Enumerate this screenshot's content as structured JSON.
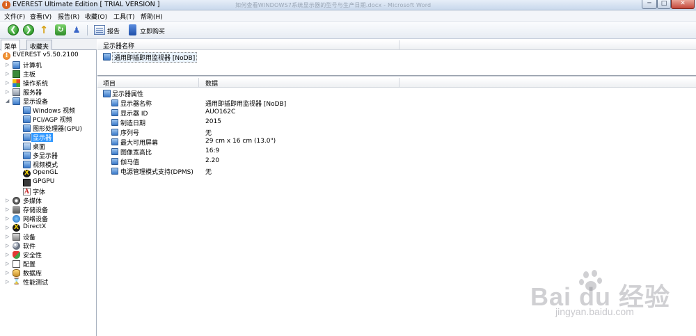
{
  "window": {
    "title": "EVEREST Ultimate Edition  [ TRIAL VERSION ]",
    "background_title": "如何查看WINDOWS7系统显示器的型号与生产日期.docx - Microsoft Word",
    "min_glyph": "─",
    "max_glyph": "□",
    "close_glyph": "✕"
  },
  "menu": [
    "文件(F)",
    "查看(V)",
    "报告(R)",
    "收藏(O)",
    "工具(T)",
    "帮助(H)"
  ],
  "toolbar": {
    "back_glyph": "❮",
    "forward_glyph": "❯",
    "up_glyph": "↑",
    "refresh_glyph": "↻",
    "users_glyph": "♟",
    "report_label": "报告",
    "buy_label": "立即购买"
  },
  "left_tabs": {
    "menu": "菜单",
    "favorites": "收藏夹"
  },
  "tree": {
    "root": "EVEREST v5.50.2100",
    "items": [
      {
        "label": "计算机",
        "icon": "computer-icon"
      },
      {
        "label": "主板",
        "icon": "motherboard-icon"
      },
      {
        "label": "操作系统",
        "icon": "windows-icon"
      },
      {
        "label": "服务器",
        "icon": "server-icon"
      },
      {
        "label": "显示设备",
        "icon": "monitor-icon"
      }
    ],
    "display_children": [
      "Windows 视频",
      "PCI/AGP 视频",
      "图形处理器(GPU)",
      "显示器",
      "桌面",
      "多显示器",
      "视频模式",
      "OpenGL",
      "GPGPU",
      "字体"
    ],
    "more_items": [
      {
        "label": "多媒体",
        "icon": "multimedia-icon"
      },
      {
        "label": "存储设备",
        "icon": "storage-icon"
      },
      {
        "label": "网络设备",
        "icon": "network-icon"
      },
      {
        "label": "DirectX",
        "icon": "directx-icon"
      },
      {
        "label": "设备",
        "icon": "devices-icon"
      },
      {
        "label": "软件",
        "icon": "software-icon"
      },
      {
        "label": "安全性",
        "icon": "security-icon"
      },
      {
        "label": "配置",
        "icon": "config-icon"
      },
      {
        "label": "数据库",
        "icon": "database-icon"
      },
      {
        "label": "性能测试",
        "icon": "benchmark-icon"
      }
    ],
    "glyphs": {
      "expander": "▷",
      "expanded": "◢",
      "orange": "!",
      "directx": "X",
      "font": "A",
      "bench": "⌛"
    },
    "selected": "显示器"
  },
  "device_list": {
    "header": "显示器名称",
    "items": [
      "通用即插即用监视器 [NoDB]"
    ]
  },
  "properties": {
    "header_item": "项目",
    "header_data": "数据",
    "group": "显示器属性",
    "rows": [
      {
        "name": "显示器名称",
        "value": "通用即插即用监视器 [NoDB]"
      },
      {
        "name": "显示器 ID",
        "value": "AUO162C"
      },
      {
        "name": "制造日期",
        "value": "2015"
      },
      {
        "name": "序列号",
        "value": "无"
      },
      {
        "name": "最大可用屏幕",
        "value": "29 cm x 16 cm (13.0\")"
      },
      {
        "name": "图像宽高比",
        "value": "16:9"
      },
      {
        "name": "伽马值",
        "value": "2.20"
      },
      {
        "name": "电源管理模式支持(DPMS)",
        "value": "无"
      }
    ]
  },
  "watermark": {
    "text": "Bai du 经验",
    "url": "jingyan.baidu.com"
  }
}
